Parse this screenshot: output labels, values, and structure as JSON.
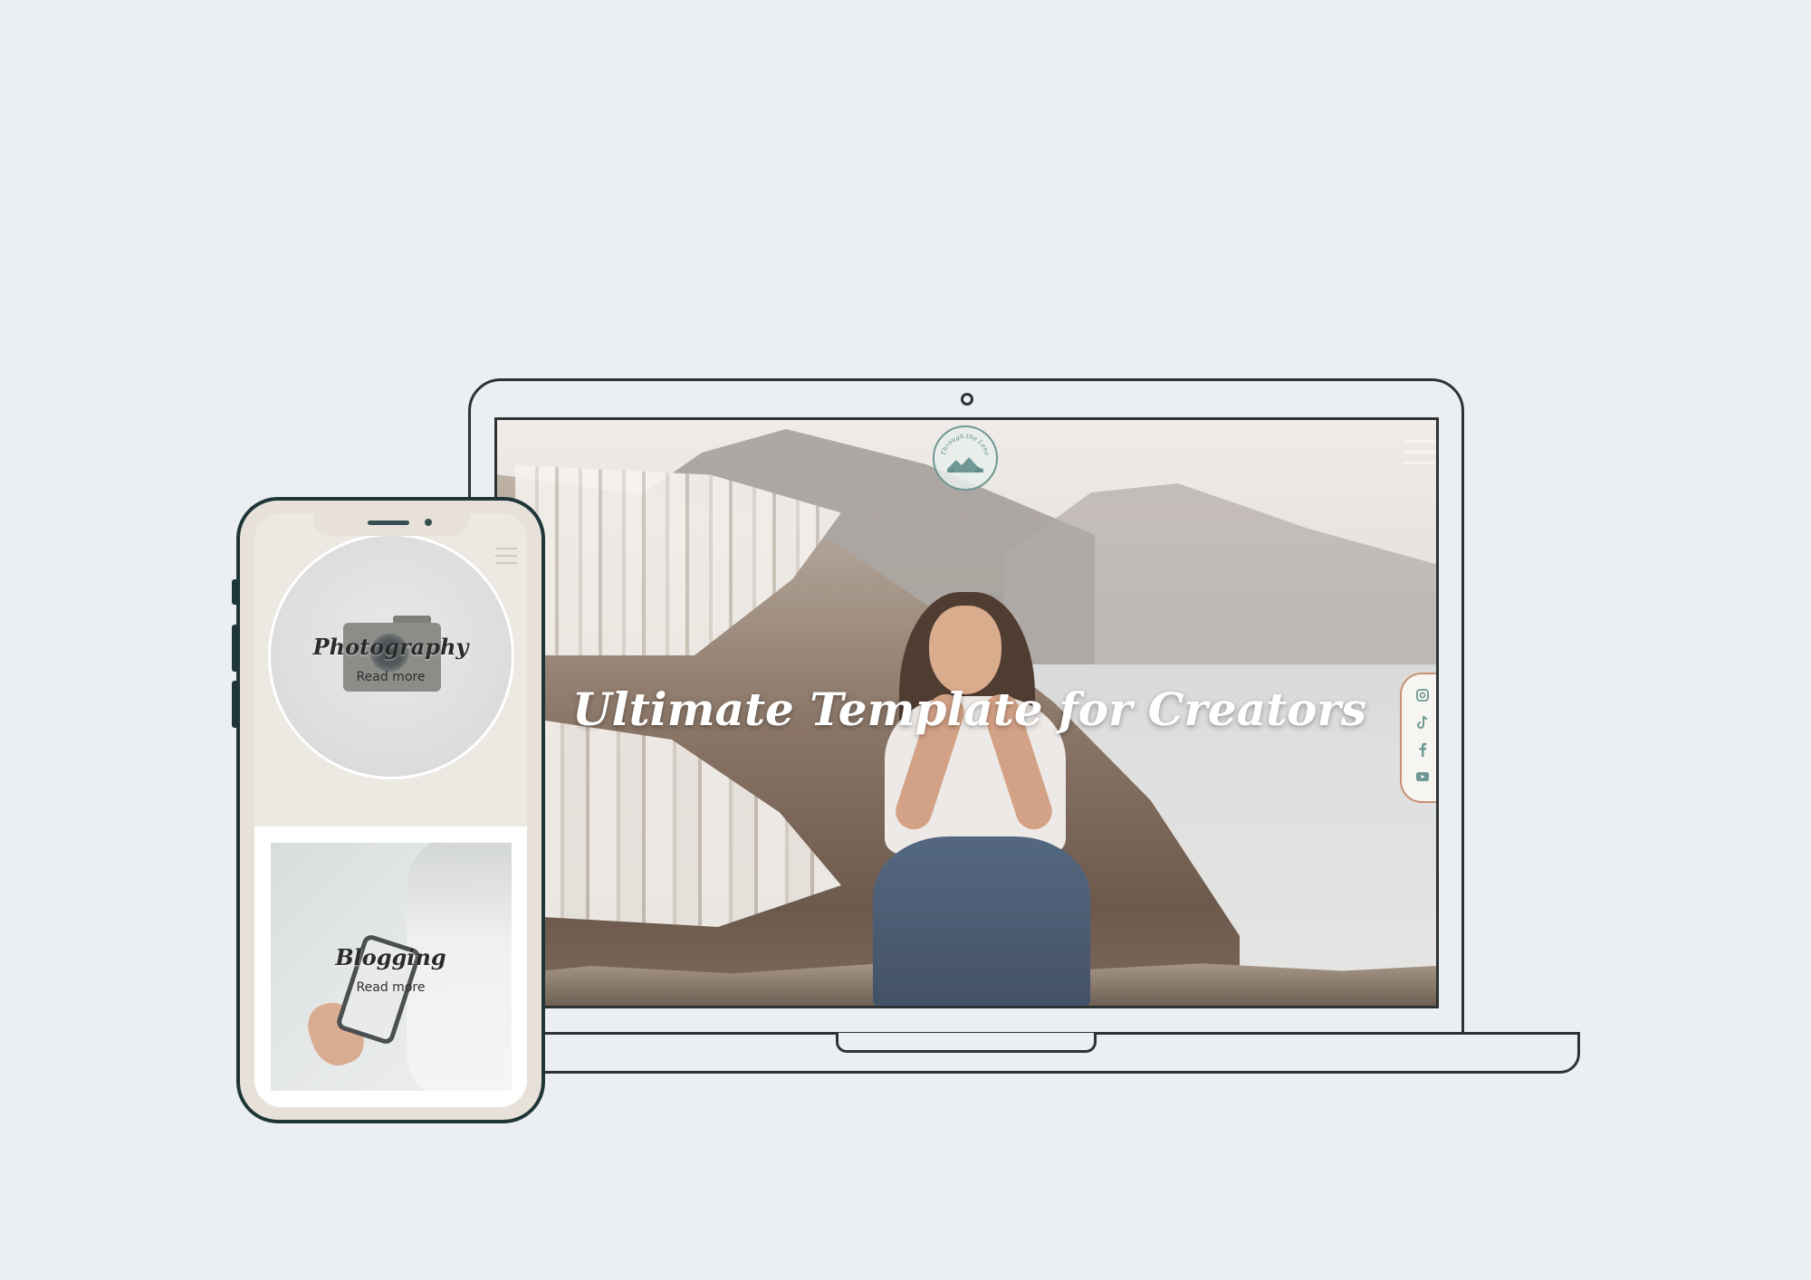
{
  "desktop": {
    "hero_title": "Ultimate Template for Creators",
    "logo_text": "Through the Lens",
    "social": {
      "icons": [
        "instagram-icon",
        "tiktok-icon",
        "facebook-icon",
        "youtube-icon"
      ],
      "border_color": "#c88f72",
      "icon_color": "#6f9894"
    }
  },
  "mobile": {
    "cards": [
      {
        "title": "Photography",
        "link": "Read more"
      },
      {
        "title": "Blogging",
        "link": "Read more"
      }
    ]
  },
  "colors": {
    "background": "#eceff2",
    "device_outline": "#2d3232",
    "phone_outline": "#1f3638",
    "accent": "#6f9894"
  }
}
